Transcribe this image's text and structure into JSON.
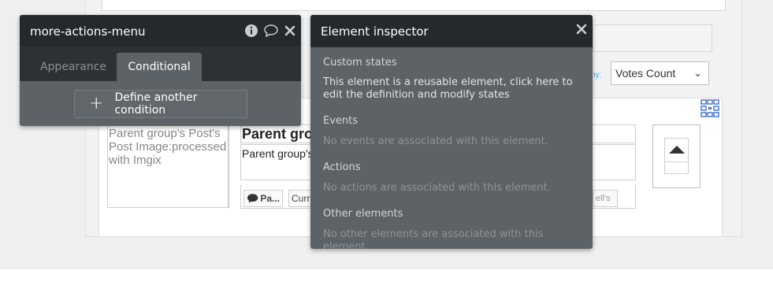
{
  "background_page": {
    "sort_by_label": "by:",
    "sort_select_value": "Votes Count",
    "image_placeholder_text": "Parent group's Post's Post Image:processed with Imgix",
    "post_title_text": "Parent gro",
    "post_body_text": "Parent group's",
    "comment_chip_label": "Pa...",
    "current_chip_label": "Curr",
    "cells_chip_label": "ell's"
  },
  "more_actions_panel": {
    "title": "more-actions-menu",
    "tabs": [
      {
        "label": "Appearance",
        "active": false
      },
      {
        "label": "Conditional",
        "active": true
      }
    ],
    "define_button_label": "Define another condition"
  },
  "element_inspector": {
    "title": "Element inspector",
    "sections": [
      {
        "title": "Custom states",
        "text": "This element is a reusable element, click here to edit the definition and modify states"
      },
      {
        "title": "Events",
        "text": "No events are associated with this element."
      },
      {
        "title": "Actions",
        "text": "No actions are associated with this element."
      },
      {
        "title": "Other elements",
        "text": "No other elements are associated with this element."
      }
    ]
  },
  "colors": {
    "panel_header": "#25292b",
    "panel_body": "#5d6266",
    "accent_link": "#4aa3df"
  },
  "icons": [
    "info-icon",
    "comment-icon",
    "close-icon",
    "plus-icon",
    "chevron-down-icon",
    "arrow-up-icon",
    "grid-icon"
  ]
}
